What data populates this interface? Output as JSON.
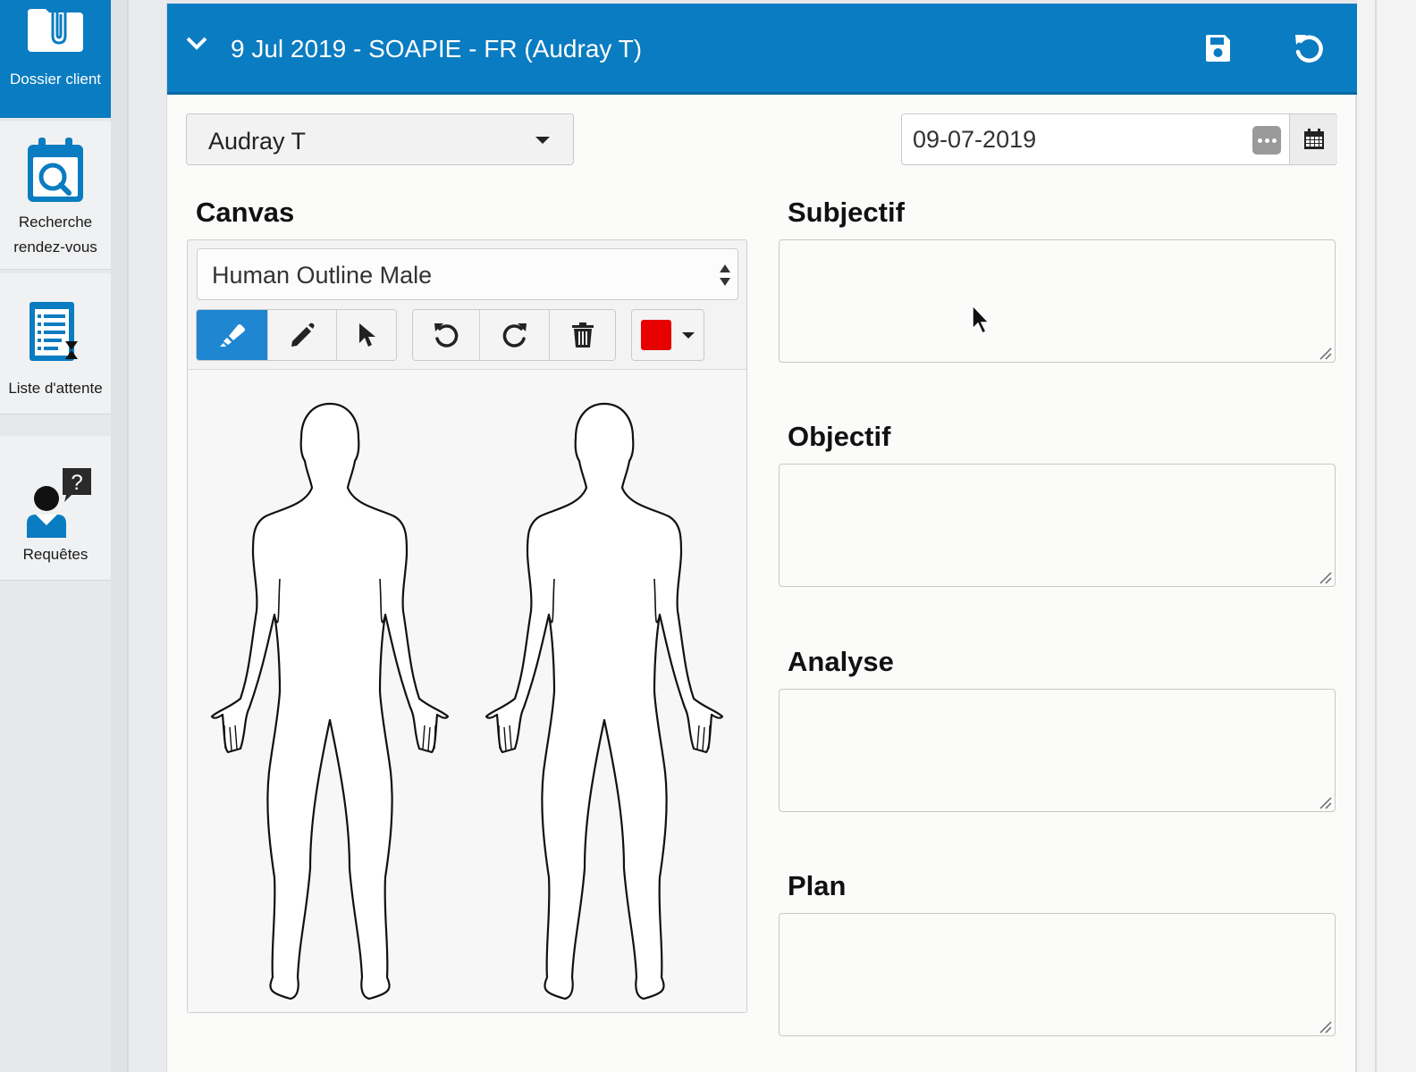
{
  "sidebar": {
    "items": [
      {
        "label": "Dossier client",
        "icon": "clipboard-folder-icon",
        "active": true
      },
      {
        "label_line1": "Recherche",
        "label_line2": "rendez-vous",
        "icon": "calendar-search-icon"
      },
      {
        "label": "Liste d'attente",
        "icon": "waiting-list-icon"
      },
      {
        "label": "Requêtes",
        "icon": "support-request-icon"
      }
    ]
  },
  "header": {
    "title": "9 Jul 2019 - SOAPIE - FR (Audray T)",
    "save_icon": "floppy-disk-icon",
    "reset_icon": "undo-icon"
  },
  "form": {
    "user_select": {
      "value": "Audray T"
    },
    "date": {
      "value": "09-07-2019"
    }
  },
  "canvas": {
    "title": "Canvas",
    "template": {
      "value": "Human Outline Male"
    },
    "tools": [
      "highlighter-icon",
      "pencil-icon",
      "pointer-icon",
      "undo-icon",
      "redo-icon",
      "trash-icon"
    ],
    "color": "#e60000"
  },
  "sections": {
    "subjectif": "Subjectif",
    "objectif": "Objectif",
    "analyse": "Analyse",
    "plan": "Plan"
  },
  "colors": {
    "accent": "#0a7cc1",
    "active_tool": "#1f86d1"
  }
}
